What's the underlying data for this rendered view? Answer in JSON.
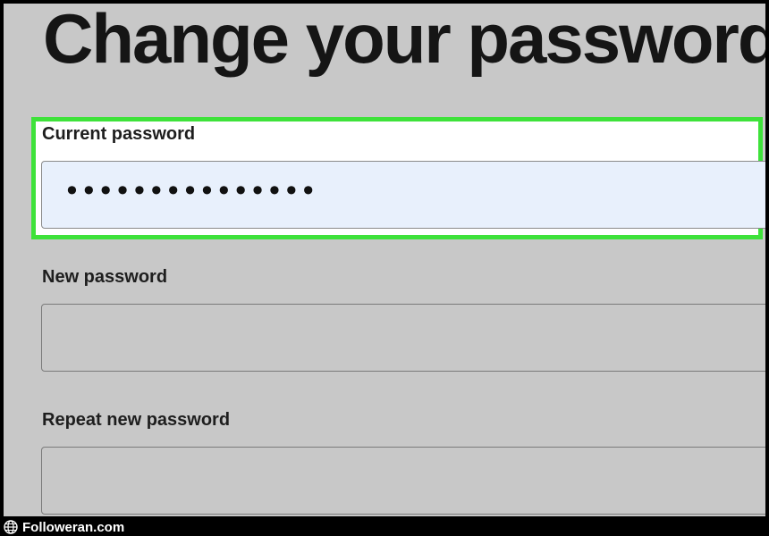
{
  "page": {
    "title": "Change your password"
  },
  "form": {
    "current_password": {
      "label": "Current password",
      "value": "•••••••••••••••"
    },
    "new_password": {
      "label": "New password",
      "value": ""
    },
    "repeat_password": {
      "label": "Repeat new password",
      "value": ""
    }
  },
  "highlight": {
    "color": "#3ee23a",
    "target": "current_password"
  },
  "watermark": {
    "icon": "globe-icon",
    "text": "Followeran.com"
  },
  "colors": {
    "background": "#c8c8c8",
    "focused_input": "#e8f0fc"
  }
}
